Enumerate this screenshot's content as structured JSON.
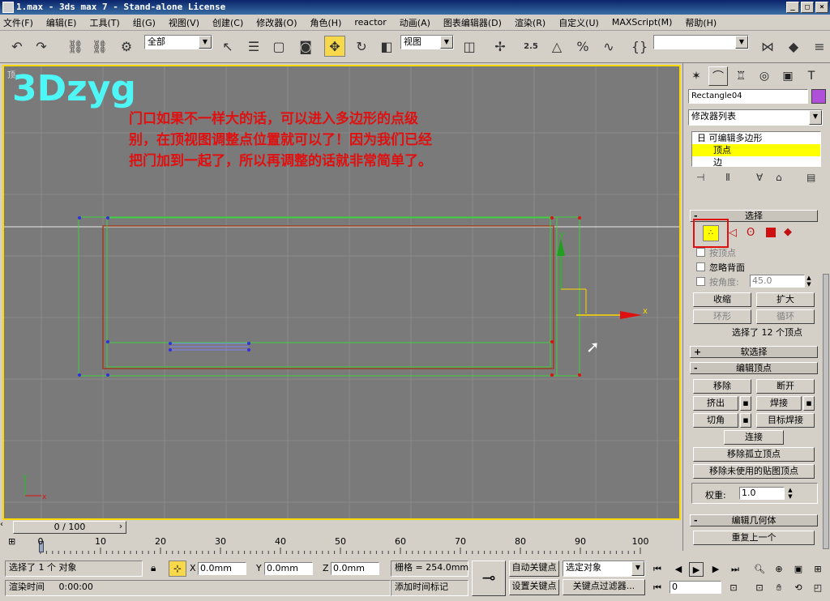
{
  "window": {
    "title": "1.max - 3ds max 7 - Stand-alone License",
    "controls": [
      "_",
      "□",
      "×"
    ]
  },
  "menu": [
    "文件(F)",
    "编辑(E)",
    "工具(T)",
    "组(G)",
    "视图(V)",
    "创建(C)",
    "修改器(O)",
    "角色(H)",
    "reactor",
    "动画(A)",
    "图表编辑器(D)",
    "渲染(R)",
    "自定义(U)",
    "MAXScript(M)",
    "帮助(H)"
  ],
  "toolbar": {
    "selection_filter": "全部",
    "ref_coord": "视图",
    "snap_value": "2.5"
  },
  "viewport": {
    "label": "顶",
    "watermark": "3Dzyg",
    "note": [
      "门口如果不一样大的话，可以进入多边形的点级",
      "别，在顶视图调整点位置就可以了！因为我们已经",
      "把门加到一起了，所以再调整的话就非常简单了。"
    ],
    "axis_x": "x",
    "axis_y": "y"
  },
  "panel": {
    "object_name": "Rectangle04",
    "object_color": "#b04fd8",
    "modifier_list": "修改器列表",
    "stack": [
      "日 可编辑多边形",
      "顶点",
      "边"
    ],
    "selection_header": "选择",
    "by_vertex": "按顶点",
    "ignore_backfacing": "忽略背面",
    "by_angle": "按角度:",
    "angle_value": "45.0",
    "shrink": "收缩",
    "grow": "扩大",
    "ring": "环形",
    "loop": "循环",
    "selected_count": "选择了 12 个顶点",
    "soft_selection": "软选择",
    "edit_vertices": "编辑顶点",
    "remove": "移除",
    "break": "断开",
    "extrude": "挤出",
    "weld": "焊接",
    "chamfer": "切角",
    "target_weld": "目标焊接",
    "connect": "连接",
    "remove_isolated": "移除孤立顶点",
    "remove_unused_map": "移除未使用的贴图顶点",
    "weight_label": "权重:",
    "weight_value": "1.0",
    "edit_geometry": "编辑几何体",
    "repeat_last": "重复上一个"
  },
  "timeline": {
    "slider": "0 / 100",
    "ticks": [
      "0",
      "10",
      "20",
      "30",
      "40",
      "50",
      "60",
      "70",
      "80",
      "90",
      "100"
    ]
  },
  "status": {
    "selected": "选择了 1 个 对象",
    "render_time_label": "渲染时间",
    "render_time": "0:00:00",
    "x": "0.0mm",
    "y": "0.0mm",
    "z": "0.0mm",
    "grid": "栅格 = 254.0mm",
    "add_time_tag": "添加时间标记",
    "auto_key": "自动关键点",
    "set_key": "设置关键点",
    "selected_object": "选定对象",
    "key_filters": "关键点过滤器...",
    "frame": "0"
  }
}
